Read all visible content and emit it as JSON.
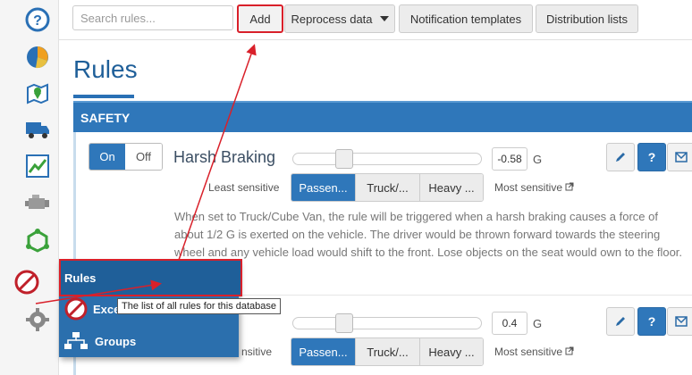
{
  "toolbar": {
    "search_placeholder": "Search rules...",
    "add_label": "Add",
    "reprocess_label": "Reprocess data",
    "notification_label": "Notification templates",
    "distribution_label": "Distribution lists"
  },
  "page": {
    "title": "Rules",
    "section": "SAFETY"
  },
  "rules": [
    {
      "on_label": "On",
      "off_label": "Off",
      "name": "Harsh Braking",
      "value": "-0.58",
      "unit": "G",
      "least_label": "Least sensitive",
      "most_label": "Most sensitive",
      "options": [
        "Passen...",
        "Truck/...",
        "Heavy ..."
      ],
      "selected_option": "Passen...",
      "description": "When set to Truck/Cube Van, the rule will be triggered when a harsh braking causes a force of about 1/2 G is exerted on the vehicle. The driver would be thrown forward towards the steering wheel and any vehicle load would shift to the front. Lose objects on the seat would own to the floor."
    },
    {
      "value": "0.4",
      "unit": "G",
      "least_label": "nsitive",
      "most_label": "Most sensitive",
      "options": [
        "Passen...",
        "Truck/...",
        "Heavy ..."
      ],
      "selected_option": "Passen..."
    }
  ],
  "menu": {
    "items": [
      {
        "label": "Rules",
        "icon": "rules-icon"
      },
      {
        "label": "Exce",
        "icon": "exceptions-icon"
      },
      {
        "label": "Groups",
        "icon": "groups-icon"
      }
    ],
    "tooltip": "The list of all rules for this database"
  },
  "rail_icons": [
    "help-icon",
    "pie-chart-icon",
    "map-icon",
    "truck-icon",
    "trend-chart-icon",
    "engine-icon",
    "zone-icon",
    "rules-icon",
    "gear-icon"
  ],
  "colors": {
    "accent": "#2f77ba",
    "title": "#1f5f99",
    "highlight": "#d9202a"
  }
}
